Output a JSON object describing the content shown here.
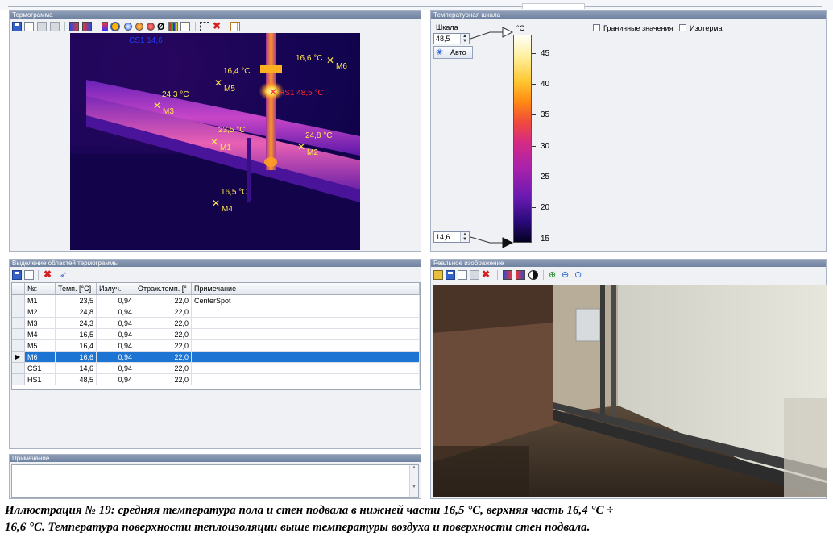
{
  "thermogram_panel": {
    "title": "Термограмма",
    "markers": [
      {
        "id": "M6",
        "temp": "16,6 °C"
      },
      {
        "id": "M5",
        "temp": "16,4 °C"
      },
      {
        "id": "M3",
        "temp": "24,3 °C"
      },
      {
        "id": "HS1",
        "label": "HS1 48,5 °C"
      },
      {
        "id": "M1",
        "temp": "23,5 °C"
      },
      {
        "id": "M2",
        "temp": "24,8 °C"
      },
      {
        "id": "M4",
        "temp": "16,5 °C"
      },
      {
        "id": "CS1",
        "label": "CS1 14,6"
      }
    ]
  },
  "scale_panel": {
    "title": "Температурная шкала",
    "scale_label": "Шкала",
    "max_value": "48,5",
    "min_value": "14,6",
    "auto_label": "Авто",
    "unit": "°C",
    "ticks": [
      "45",
      "40",
      "35",
      "30",
      "25",
      "20",
      "15"
    ],
    "boundary_label": "Граничные значения",
    "isotherm_label": "Изотерма",
    "boundary_checked": false,
    "isotherm_checked": false
  },
  "regions_panel": {
    "title": "Выделение областей термограммы",
    "columns": [
      "№:",
      "Темп. [°C]",
      "Излуч.",
      "Отраж.темп. [°",
      "Примечание"
    ],
    "rows": [
      {
        "id": "M1",
        "temp": "23,5",
        "emis": "0,94",
        "refl": "22,0",
        "note": "CenterSpot"
      },
      {
        "id": "M2",
        "temp": "24,8",
        "emis": "0,94",
        "refl": "22,0",
        "note": ""
      },
      {
        "id": "M3",
        "temp": "24,3",
        "emis": "0,94",
        "refl": "22,0",
        "note": ""
      },
      {
        "id": "M4",
        "temp": "16,5",
        "emis": "0,94",
        "refl": "22,0",
        "note": ""
      },
      {
        "id": "M5",
        "temp": "16,4",
        "emis": "0,94",
        "refl": "22,0",
        "note": ""
      },
      {
        "id": "M6",
        "temp": "16,6",
        "emis": "0,94",
        "refl": "22,0",
        "note": ""
      },
      {
        "id": "CS1",
        "temp": "14,6",
        "emis": "0,94",
        "refl": "22,0",
        "note": ""
      },
      {
        "id": "HS1",
        "temp": "48,5",
        "emis": "0,94",
        "refl": "22,0",
        "note": ""
      }
    ],
    "selected_row": "M6"
  },
  "note_panel": {
    "title": "Примечание"
  },
  "photo_panel": {
    "title": "Реальное изображение"
  },
  "caption": {
    "line1": "Иллюстрация № 19: средняя температура пола и стен подвала в нижней части 16,5 °C, верхняя часть 16,4 °C ÷",
    "line2": "16,6 °C. Температура поверхности теплоизоляции выше температуры воздуха и поверхности стен подвала."
  },
  "colors": {
    "selection": "#1e74d2",
    "marker": "#ffe94a",
    "hotspot": "#ff2a2a",
    "coldspot": "#1a3cff"
  }
}
